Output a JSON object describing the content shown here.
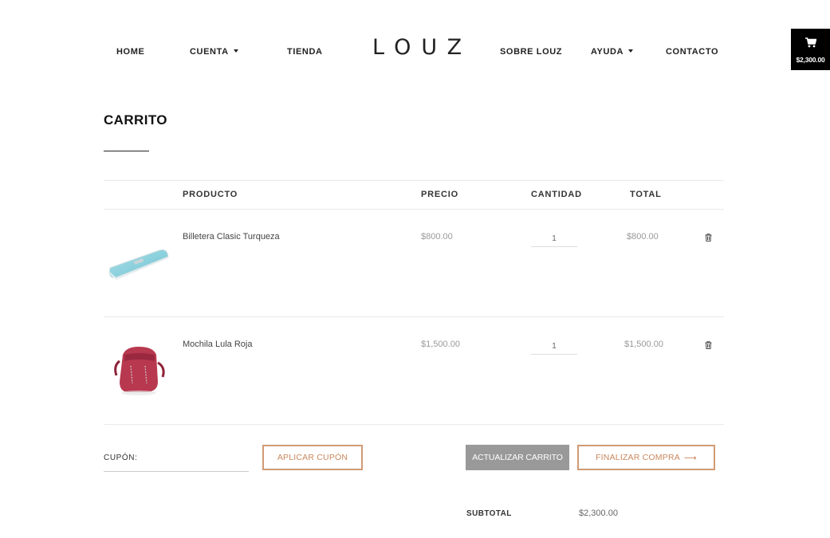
{
  "header": {
    "logo": "LOUZ",
    "nav": {
      "home": "HOME",
      "cuenta": "CUENTA",
      "tienda": "TIENDA",
      "sobre": "SOBRE LOUZ",
      "ayuda": "AYUDA",
      "contacto": "CONTACTO"
    },
    "cart_total": "$2,300.00"
  },
  "page": {
    "title": "CARRITO"
  },
  "table": {
    "headers": {
      "product": "PRODUCTO",
      "price": "PRECIO",
      "quantity": "CANTIDAD",
      "total": "TOTAL"
    },
    "items": [
      {
        "name": "Billetera Clasic Turqueza",
        "price": "$800.00",
        "quantity": "1",
        "total": "$800.00",
        "image": "turquoise-wallet"
      },
      {
        "name": "Mochila Lula Roja",
        "price": "$1,500.00",
        "quantity": "1",
        "total": "$1,500.00",
        "image": "red-backpack"
      }
    ]
  },
  "actions": {
    "coupon_label": "CUPÓN:",
    "apply_coupon": "APLICAR CUPÓN",
    "update_cart": "ACTUALIZAR CARRITO",
    "checkout": "FINALIZAR COMPRA",
    "checkout_arrow": "⟶"
  },
  "totals": {
    "subtotal_label": "SUBTOTAL",
    "subtotal_value": "$2,300.00"
  },
  "colors": {
    "accent": "#d19a74",
    "button_gray": "#999999",
    "cart_widget_bg": "#000000"
  }
}
